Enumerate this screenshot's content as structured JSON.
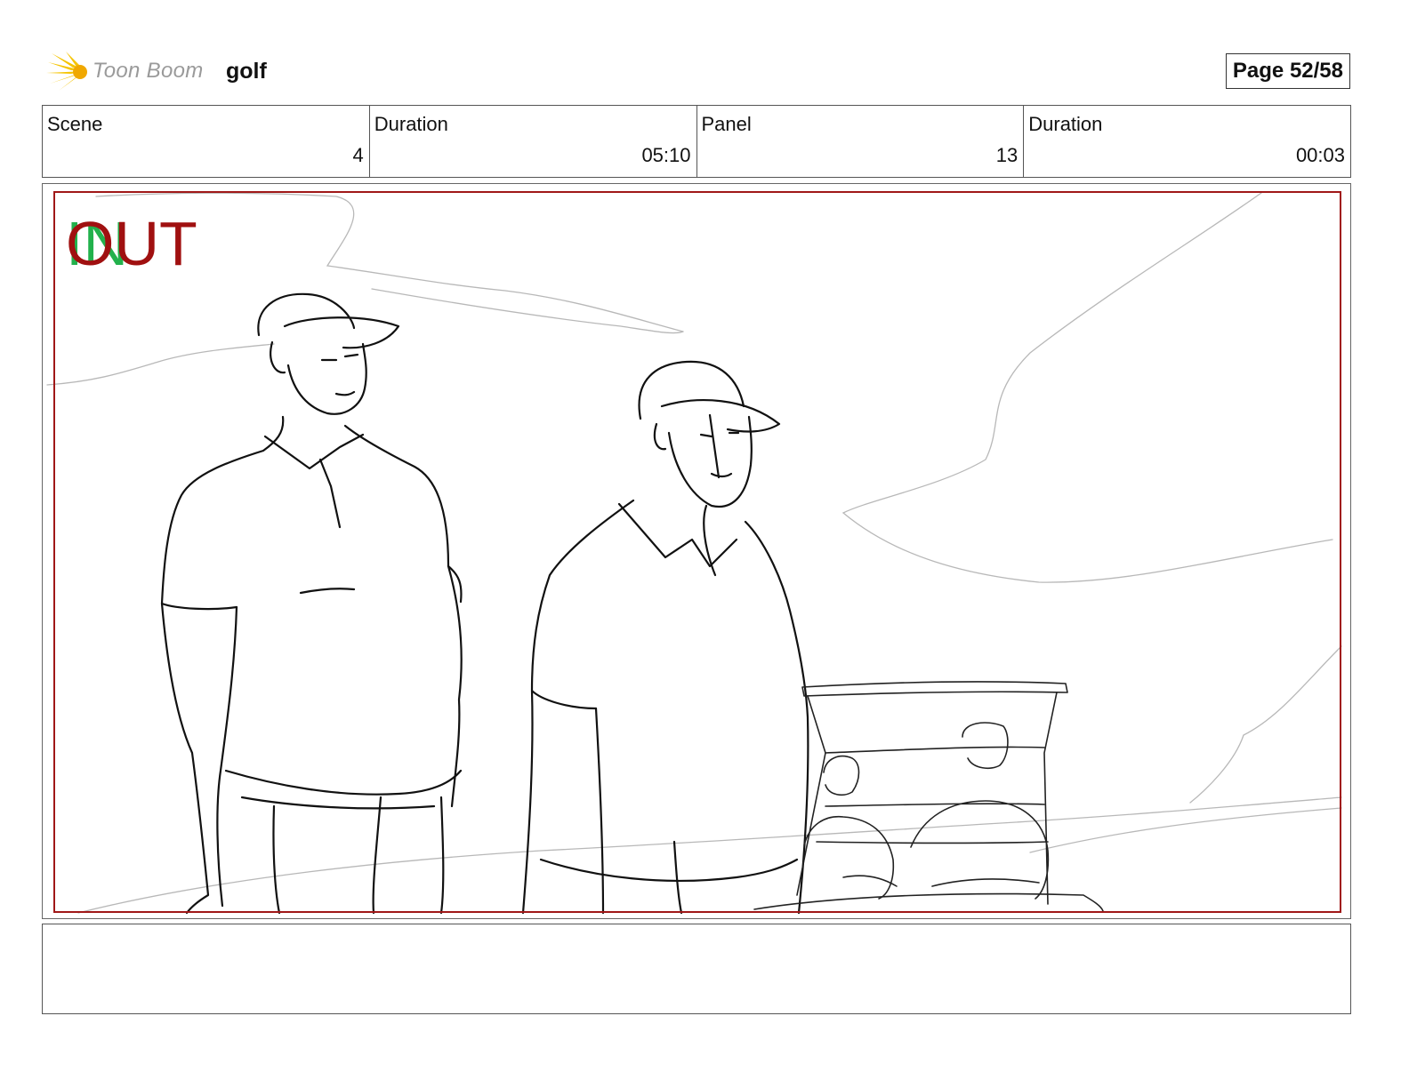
{
  "header": {
    "logo_text": "Toon Boom",
    "logo_icon": "toon-boom-starburst-icon",
    "project_title": "golf",
    "page_label": "Page 52/58"
  },
  "info": [
    {
      "label": "Scene",
      "value": "4"
    },
    {
      "label": "Duration",
      "value": "05:10"
    },
    {
      "label": "Panel",
      "value": "13"
    },
    {
      "label": "Duration",
      "value": "00:03"
    }
  ],
  "panel": {
    "in_marker": "IN",
    "out_marker": "OUT",
    "frame_color": "#a01818",
    "in_color": "#22b14c",
    "out_color": "#a01010"
  },
  "notes": {
    "text": ""
  }
}
